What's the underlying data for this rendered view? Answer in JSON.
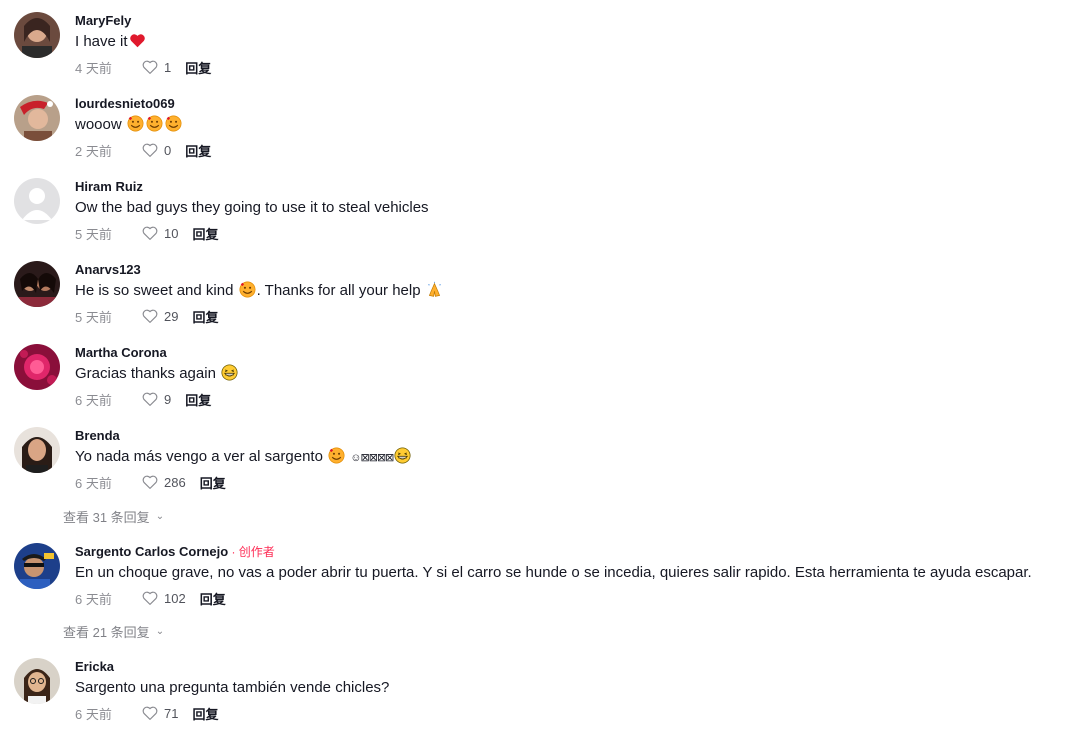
{
  "comments": [
    {
      "username": "MaryFely",
      "text": "I have it",
      "time": "4 天前",
      "likes": "1",
      "reply_label": "回复"
    },
    {
      "username": "lourdesnieto069",
      "text": "wooow",
      "time": "2 天前",
      "likes": "0",
      "reply_label": "回复"
    },
    {
      "username": "Hiram Ruiz",
      "text": "Ow the bad guys they going to use it to steal vehicles",
      "time": "5 天前",
      "likes": "10",
      "reply_label": "回复"
    },
    {
      "username": "Anarvs123",
      "text_before": "He is so sweet and kind",
      "text_after": ". Thanks for all your help",
      "time": "5 天前",
      "likes": "29",
      "reply_label": "回复"
    },
    {
      "username": "Martha Corona",
      "text": "Gracias thanks again",
      "time": "6 天前",
      "likes": "9",
      "reply_label": "回复"
    },
    {
      "username": "Brenda",
      "text": "Yo nada más vengo a ver al sargento",
      "boxes": "☺⊠⊠⊠⊠",
      "time": "6 天前",
      "likes": "286",
      "reply_label": "回复",
      "view_replies": "查看 31 条回复"
    },
    {
      "username": "Sargento Carlos Cornejo",
      "creator_tag": " · 创作者",
      "text": "En un choque grave, no vas a poder abrir tu puerta. Y si el carro se hunde o se incedia, quieres salir rapido. Esta herramienta te ayuda escapar.",
      "time": "6 天前",
      "likes": "102",
      "reply_label": "回复",
      "view_replies": "查看 21 条回复"
    },
    {
      "username": "Ericka",
      "text": "Sargento una pregunta también vende chicles?",
      "time": "6 天前",
      "likes": "71",
      "reply_label": "回复"
    }
  ],
  "icons": {
    "like": "heart-outline-icon",
    "expand": "chevron-down-icon"
  },
  "colors": {
    "creator_tag": "#fe2c55",
    "meta_text": "#8a8b91"
  }
}
